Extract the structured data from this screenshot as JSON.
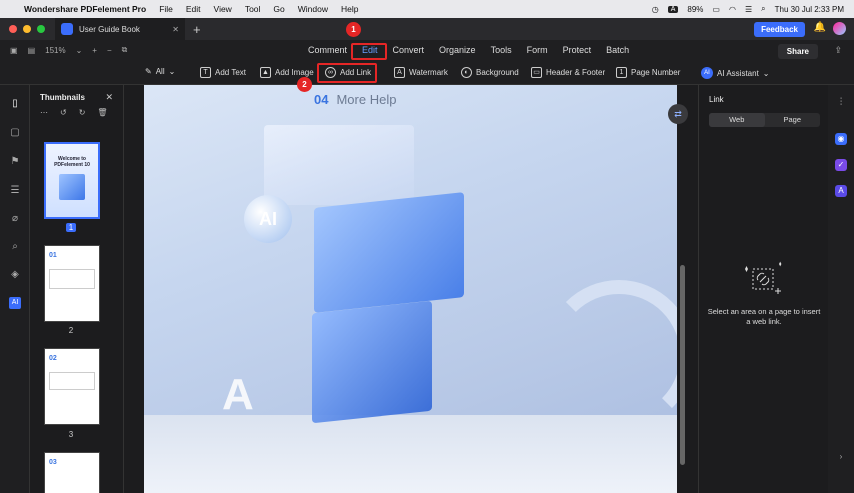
{
  "menubar": {
    "app_name": "Wondershare PDFelement Pro",
    "items": [
      "File",
      "Edit",
      "View",
      "Tool",
      "Go",
      "Window",
      "Help"
    ],
    "status_letter": "A",
    "battery": "89%",
    "datetime": "Thu 30 Jul  2:33 PM"
  },
  "tab": {
    "title": "User Guide Book"
  },
  "header": {
    "feedback": "Feedback"
  },
  "toolbar1": {
    "zoom": "151%",
    "nav": [
      "Comment",
      "Edit",
      "Convert",
      "Organize",
      "Tools",
      "Form",
      "Protect",
      "Batch"
    ],
    "share": "Share"
  },
  "toolbar2": {
    "all": "All",
    "add_text": "Add Text",
    "add_image": "Add Image",
    "add_link": "Add Link",
    "watermark": "Watermark",
    "background": "Background",
    "header_footer": "Header & Footer",
    "page_number": "Page Number",
    "ai_assistant": "AI Assistant"
  },
  "thumbnails": {
    "title": "Thumbnails",
    "pages": [
      "1",
      "2",
      "3"
    ],
    "p1_heading": "Welcome to PDFelement 10",
    "p2_num": "01",
    "p3_num": "02",
    "p4_num": "03"
  },
  "document": {
    "section_num": "04",
    "section_title": "More Help",
    "ai_label": "AI"
  },
  "annotations": {
    "badge1": "1",
    "badge2": "2"
  },
  "link_panel": {
    "title": "Link",
    "tab_web": "Web",
    "tab_page": "Page",
    "hint": "Select an area on a page to insert a web link."
  },
  "colors": {
    "accent": "#3b6dfb",
    "highlight": "#e52626",
    "edit_active": "#6aa0ff"
  }
}
